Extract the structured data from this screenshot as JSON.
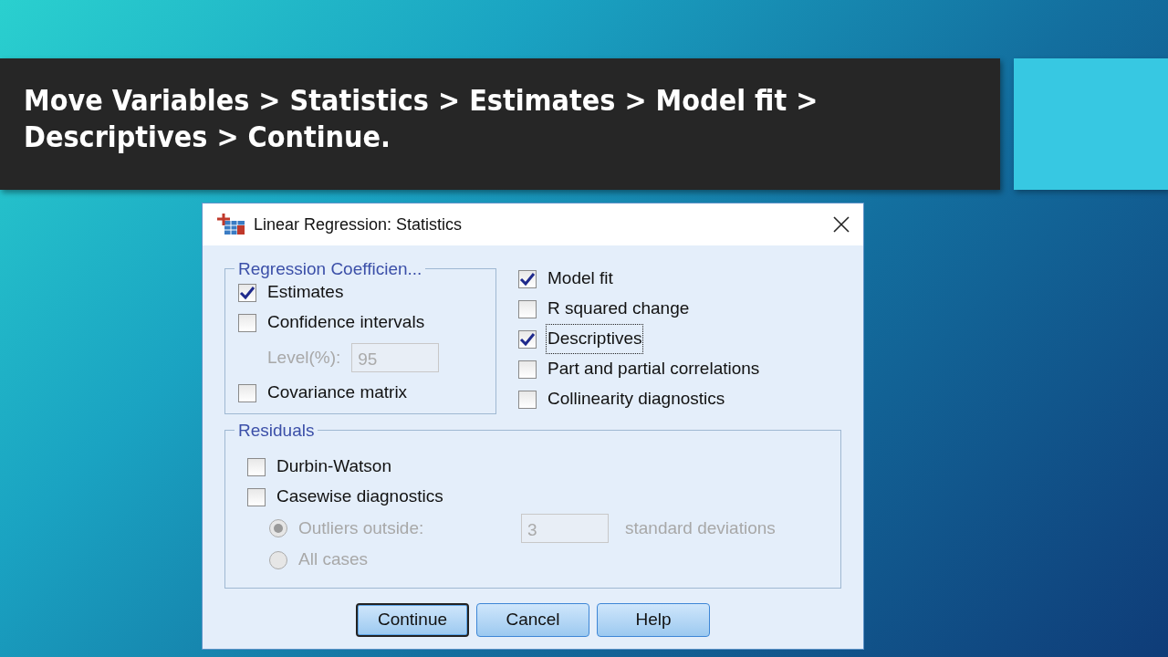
{
  "slide": {
    "caption": "Move Variables > Statistics > Estimates > Model fit > Descriptives > Continue."
  },
  "dialog": {
    "title": "Linear Regression: Statistics",
    "coefficients": {
      "legend": "Regression Coefficien...",
      "options": [
        {
          "kind": "checkbox",
          "label": "Estimates",
          "checked": true,
          "disabled": false
        },
        {
          "kind": "checkbox",
          "label": "Confidence intervals",
          "checked": false,
          "disabled": false
        },
        {
          "kind": "field",
          "label": "Level(%):",
          "value": "95",
          "disabled": true
        },
        {
          "kind": "checkbox",
          "label": "Covariance matrix",
          "checked": false,
          "disabled": false
        }
      ]
    },
    "options": [
      {
        "label": "Model fit",
        "checked": true,
        "focused": false
      },
      {
        "label": "R squared change",
        "checked": false,
        "focused": false
      },
      {
        "label": "Descriptives",
        "checked": true,
        "focused": true
      },
      {
        "label": "Part and partial correlations",
        "checked": false,
        "focused": false
      },
      {
        "label": "Collinearity diagnostics",
        "checked": false,
        "focused": false
      }
    ],
    "residuals": {
      "legend": "Residuals",
      "options": [
        {
          "kind": "checkbox",
          "label": "Durbin-Watson",
          "checked": false,
          "disabled": false
        },
        {
          "kind": "checkbox",
          "label": "Casewise diagnostics",
          "checked": false,
          "disabled": false
        },
        {
          "kind": "radio",
          "label": "Outliers outside:",
          "selected": true,
          "disabled": true,
          "value": "3",
          "suffix": "standard deviations"
        },
        {
          "kind": "radio",
          "label": "All cases",
          "selected": false,
          "disabled": true
        }
      ]
    },
    "buttons": [
      {
        "label": "Continue",
        "default": true
      },
      {
        "label": "Cancel",
        "default": false
      },
      {
        "label": "Help",
        "default": false
      }
    ]
  }
}
